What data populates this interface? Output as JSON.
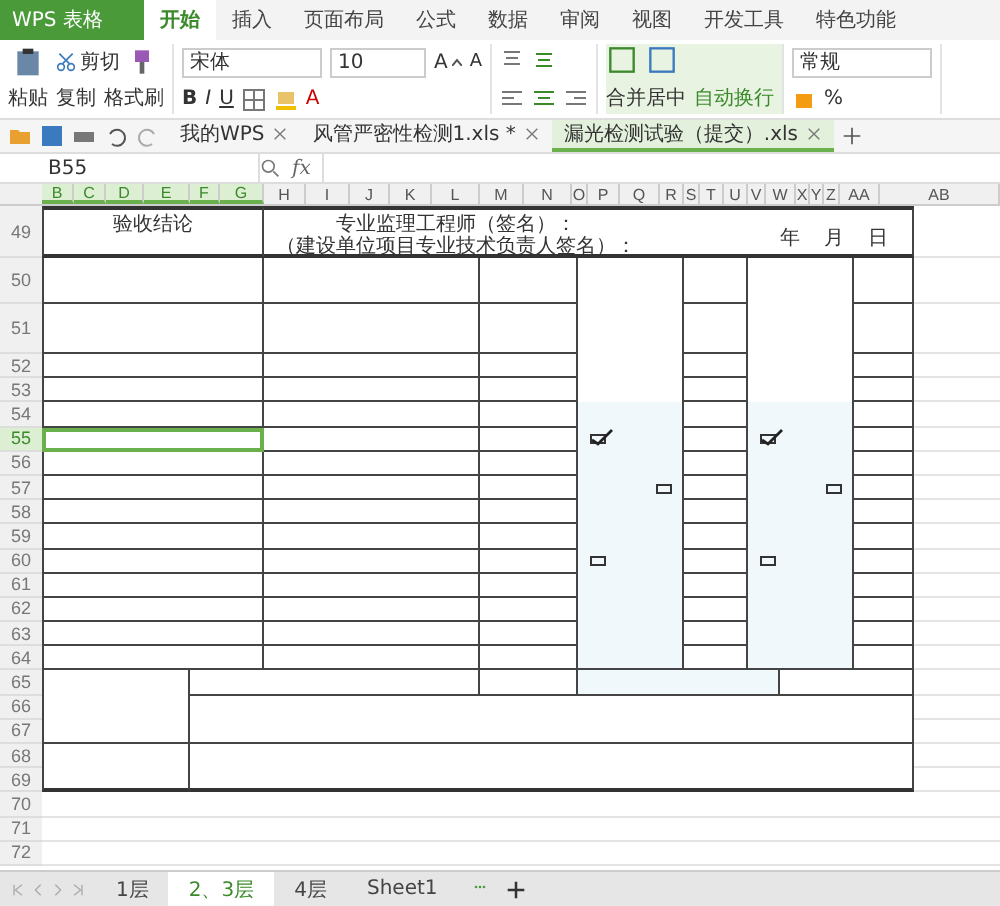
{
  "app_button": "WPS 表格",
  "menu_tabs": [
    {
      "label": "开始",
      "selected": true
    },
    {
      "label": "插入",
      "selected": false
    },
    {
      "label": "页面布局",
      "selected": false
    },
    {
      "label": "公式",
      "selected": false
    },
    {
      "label": "数据",
      "selected": false
    },
    {
      "label": "审阅",
      "selected": false
    },
    {
      "label": "视图",
      "selected": false
    },
    {
      "label": "开发工具",
      "selected": false
    },
    {
      "label": "特色功能",
      "selected": false
    }
  ],
  "ribbon": {
    "paste": "粘贴",
    "cut": "剪切",
    "copy": "复制",
    "format_painter": "格式刷",
    "font_name": "宋体",
    "font_size": "10",
    "bold": "B",
    "italic": "I",
    "underline": "U",
    "font_color": "A",
    "grow_font": "A",
    "shrink_font": "A",
    "merge": "合并居中",
    "wrap": "自动换行",
    "number_format": "常规",
    "percent": "%"
  },
  "doc_tabs": [
    {
      "label": "我的WPS",
      "selected": false
    },
    {
      "label": "风管严密性检测1.xls *",
      "selected": false
    },
    {
      "label": "漏光检测试验（提交）.xls",
      "selected": true
    }
  ],
  "name_box": "B55",
  "formula_label": "fx",
  "columns": [
    {
      "label": "B",
      "selected": true
    },
    {
      "label": "C",
      "selected": true
    },
    {
      "label": "D",
      "selected": true
    },
    {
      "label": "E",
      "selected": true
    },
    {
      "label": "F",
      "selected": true
    },
    {
      "label": "G",
      "selected": true
    },
    {
      "label": "H",
      "selected": false
    },
    {
      "label": "I",
      "selected": false
    },
    {
      "label": "J",
      "selected": false
    },
    {
      "label": "K",
      "selected": false
    },
    {
      "label": "L",
      "selected": false
    },
    {
      "label": "M",
      "selected": false
    },
    {
      "label": "N",
      "selected": false
    },
    {
      "label": "O",
      "selected": false
    },
    {
      "label": "P",
      "selected": false
    },
    {
      "label": "Q",
      "selected": false
    },
    {
      "label": "R",
      "selected": false
    },
    {
      "label": "S",
      "selected": false
    },
    {
      "label": "T",
      "selected": false
    },
    {
      "label": "U",
      "selected": false
    },
    {
      "label": "V",
      "selected": false
    },
    {
      "label": "W",
      "selected": false
    },
    {
      "label": "X",
      "selected": false
    },
    {
      "label": "Y",
      "selected": false
    },
    {
      "label": "Z",
      "selected": false
    },
    {
      "label": "AA",
      "selected": false
    },
    {
      "label": "AB",
      "selected": false
    }
  ],
  "rows": [
    {
      "label": "49",
      "selected": false
    },
    {
      "label": "50",
      "selected": false
    },
    {
      "label": "51",
      "selected": false
    },
    {
      "label": "52",
      "selected": false
    },
    {
      "label": "53",
      "selected": false
    },
    {
      "label": "54",
      "selected": false
    },
    {
      "label": "55",
      "selected": true
    },
    {
      "label": "56",
      "selected": false
    },
    {
      "label": "57",
      "selected": false
    },
    {
      "label": "58",
      "selected": false
    },
    {
      "label": "59",
      "selected": false
    },
    {
      "label": "60",
      "selected": false
    },
    {
      "label": "61",
      "selected": false
    },
    {
      "label": "62",
      "selected": false
    },
    {
      "label": "63",
      "selected": false
    },
    {
      "label": "64",
      "selected": false
    },
    {
      "label": "65",
      "selected": false
    },
    {
      "label": "66",
      "selected": false
    },
    {
      "label": "67",
      "selected": false
    },
    {
      "label": "68",
      "selected": false
    },
    {
      "label": "69",
      "selected": false
    },
    {
      "label": "70",
      "selected": false
    },
    {
      "label": "71",
      "selected": false
    },
    {
      "label": "72",
      "selected": false
    }
  ],
  "form": {
    "conclusion": "验收结论",
    "supervisor_sign": "专业监理工程师（签名）：",
    "owner_sign": "（建设单位项目专业技术负责人签名）：",
    "year": "年",
    "month": "月",
    "day": "日"
  },
  "checkboxes": [
    {
      "checked": true
    },
    {
      "checked": false
    },
    {
      "checked": false
    },
    {
      "checked": true
    },
    {
      "checked": false
    },
    {
      "checked": false
    }
  ],
  "sheet_tabs": [
    {
      "label": "1层",
      "selected": false
    },
    {
      "label": "2、3层",
      "selected": true
    },
    {
      "label": "4层",
      "selected": false
    },
    {
      "label": "Sheet1",
      "selected": false
    }
  ]
}
